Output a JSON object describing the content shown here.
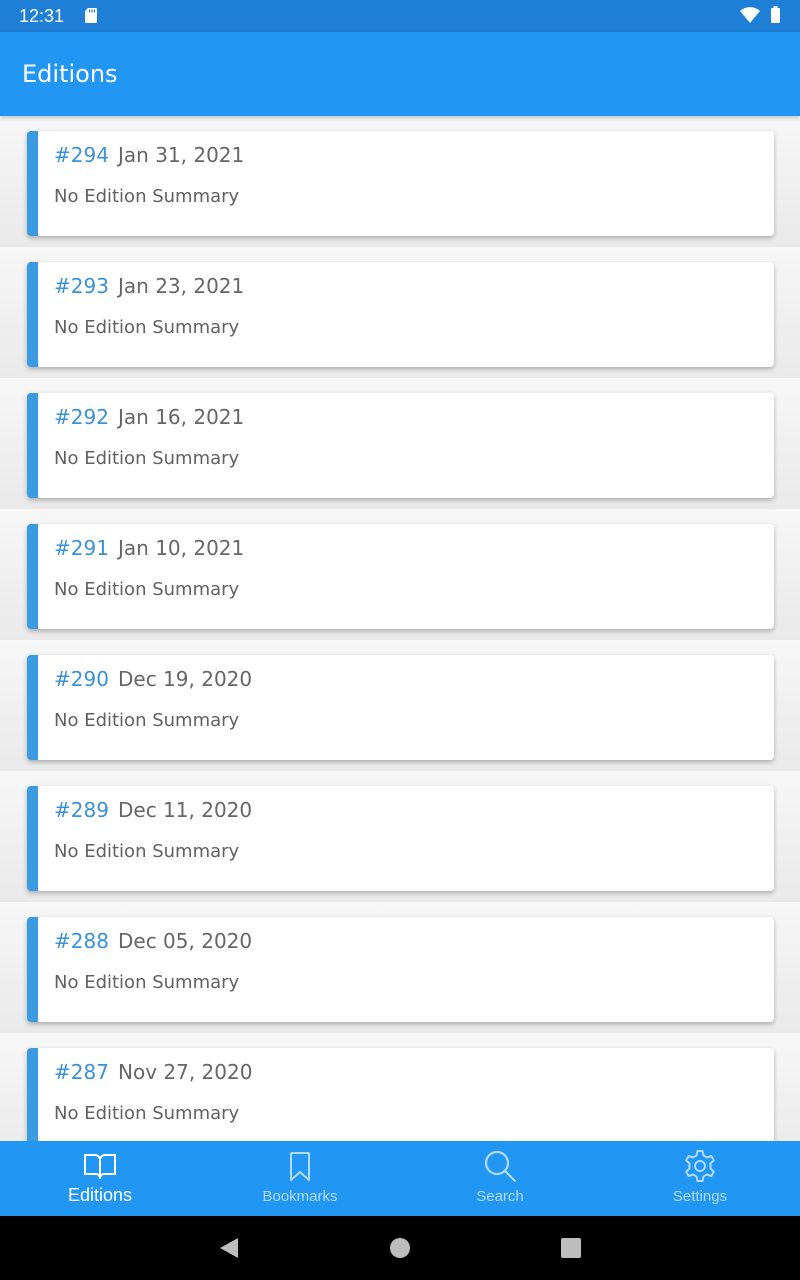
{
  "status": {
    "time": "12:31"
  },
  "app_bar": {
    "title": "Editions"
  },
  "editions": [
    {
      "number": "#294",
      "date": "Jan 31, 2021",
      "summary": "No Edition Summary"
    },
    {
      "number": "#293",
      "date": "Jan 23, 2021",
      "summary": "No Edition Summary"
    },
    {
      "number": "#292",
      "date": "Jan 16, 2021",
      "summary": "No Edition Summary"
    },
    {
      "number": "#291",
      "date": "Jan 10, 2021",
      "summary": "No Edition Summary"
    },
    {
      "number": "#290",
      "date": "Dec 19, 2020",
      "summary": "No Edition Summary"
    },
    {
      "number": "#289",
      "date": "Dec 11, 2020",
      "summary": "No Edition Summary"
    },
    {
      "number": "#288",
      "date": "Dec 05, 2020",
      "summary": "No Edition Summary"
    },
    {
      "number": "#287",
      "date": "Nov 27, 2020",
      "summary": "No Edition Summary"
    }
  ],
  "bottom_nav": {
    "items": [
      {
        "label": "Editions",
        "icon": "book-open-icon",
        "active": true
      },
      {
        "label": "Bookmarks",
        "icon": "bookmark-icon",
        "active": false
      },
      {
        "label": "Search",
        "icon": "search-icon",
        "active": false
      },
      {
        "label": "Settings",
        "icon": "gear-icon",
        "active": false
      }
    ]
  },
  "colors": {
    "app_bar": "#2196f3",
    "status_bar": "#1e7fd6",
    "accent": "#3b9be0",
    "number_text": "#3b91d6"
  }
}
